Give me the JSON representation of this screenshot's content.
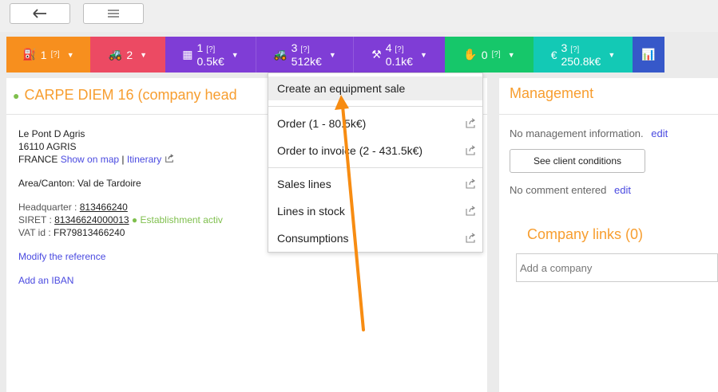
{
  "toolbar": {
    "back_icon": "back-arrow-icon",
    "list_icon": "list-icon"
  },
  "tabs": [
    {
      "name": "equipment",
      "icon": "⛽",
      "count": "1",
      "hint": "[?]",
      "amount": "",
      "color": "#f78f1e"
    },
    {
      "name": "tractor",
      "icon": "🚜",
      "count": "2",
      "hint": "",
      "amount": "",
      "color": "#ec4a63"
    },
    {
      "name": "calculator",
      "icon": "▦",
      "count": "1",
      "hint": "[?]",
      "amount": "0.5k€",
      "color": "#7f3dd6"
    },
    {
      "name": "tractor-sales",
      "icon": "🚜",
      "count": "3",
      "hint": "[?]",
      "amount": "512k€",
      "color": "#7f3dd6"
    },
    {
      "name": "tools",
      "icon": "⚒",
      "count": "4",
      "hint": "[?]",
      "amount": "0.1k€",
      "color": "#7f3dd6"
    },
    {
      "name": "approval",
      "icon": "✋",
      "count": "0",
      "hint": "[?]",
      "amount": "",
      "color": "#16c76a"
    },
    {
      "name": "invoice",
      "icon": "€",
      "count": "3",
      "hint": "[?]",
      "amount": "250.8k€",
      "color": "#13c9b5"
    },
    {
      "name": "stats",
      "icon": "📊",
      "count": "",
      "hint": "",
      "amount": "",
      "color": "#3658c9"
    }
  ],
  "company": {
    "title": "CARPE DIEM 16 (company head",
    "address_line1": "Le Pont D Agris",
    "address_line2": "16110 AGRIS",
    "country": "FRANCE",
    "show_on_map": "Show on map",
    "separator": "|",
    "itinerary": "Itinerary",
    "area": "Area/Canton: Val de Tardoire",
    "headquarter_label": "Headquarter : ",
    "headquarter_value": "813466240",
    "siret_label": "SIRET : ",
    "siret_value": "81346624000013",
    "establishment_status": "Establishment activ",
    "vat_label": "VAT id : ",
    "vat_value": "FR79813466240",
    "modify_reference": "Modify the reference",
    "add_iban": "Add an IBAN"
  },
  "management": {
    "title": "Management",
    "no_info": "No management information.",
    "edit": "edit",
    "client_conditions_button": "See client conditions",
    "no_comment": "No comment entered",
    "edit2": "edit",
    "company_links_title": "Company links (0)",
    "add_company_placeholder": "Add a company"
  },
  "dropdown": {
    "items": [
      {
        "label": "Create an equipment sale",
        "external": false
      },
      {
        "label": "Order (1 - 80.5k€)",
        "external": true
      },
      {
        "label": "Order to invoice (2 - 431.5k€)",
        "external": true
      },
      {
        "label": "Sales lines",
        "external": true
      },
      {
        "label": "Lines in stock",
        "external": true
      },
      {
        "label": "Consumptions",
        "external": true
      }
    ]
  },
  "colors": {
    "accent_orange": "#f79e30",
    "link_blue": "#4a4ae0",
    "status_green": "#7fbf4d"
  }
}
